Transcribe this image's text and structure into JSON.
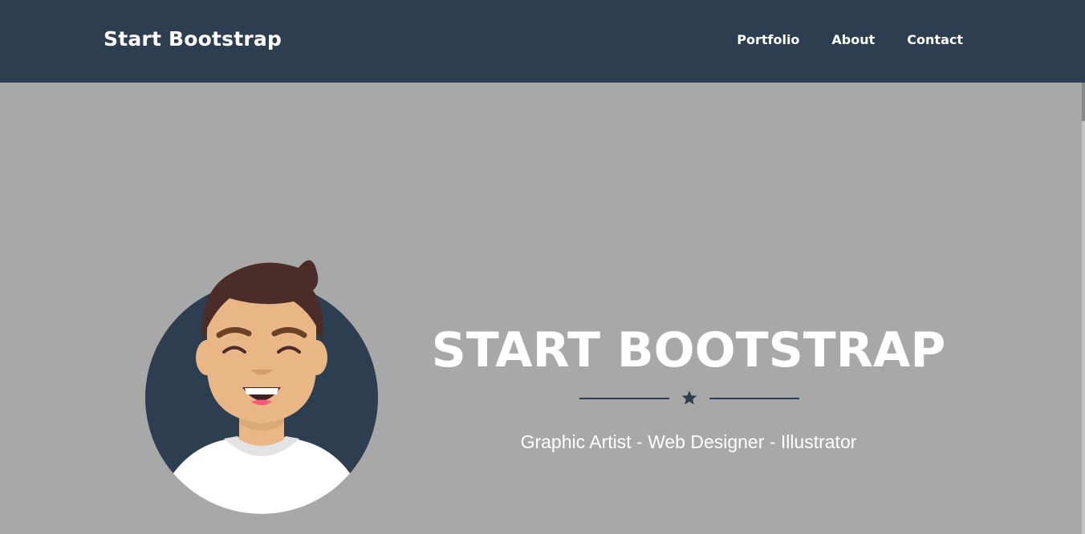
{
  "navbar": {
    "brand": "Start Bootstrap",
    "links": [
      {
        "label": "Portfolio"
      },
      {
        "label": "About"
      },
      {
        "label": "Contact"
      }
    ],
    "background": "#2c3e50"
  },
  "masthead": {
    "avatar_icon": "smiling-man-avatar",
    "heading": "START BOOTSTRAP",
    "divider_icon": "star-icon",
    "subheading": "Graphic Artist - Web Designer - Illustrator",
    "background": "#a8a8a8"
  }
}
